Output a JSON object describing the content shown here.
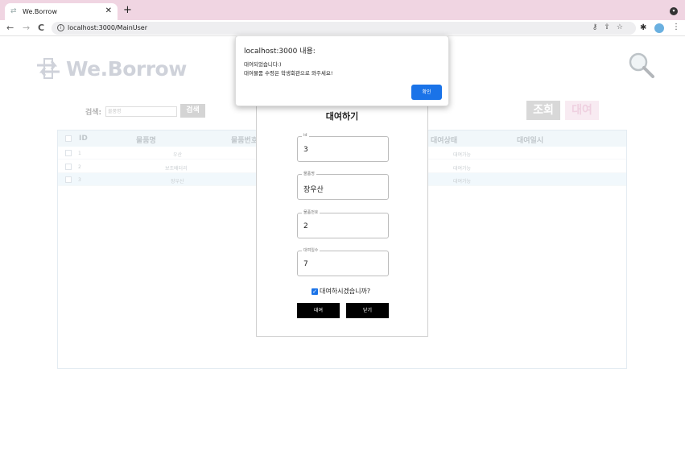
{
  "browser": {
    "tab_title": "We.Borrow",
    "tab_close": "✕",
    "new_tab": "+",
    "url": "localhost:3000/MainUser",
    "back": "←",
    "forward": "→",
    "reload": "C"
  },
  "page": {
    "logo_text": "We.Borrow",
    "search_label": "검색:",
    "search_placeholder": "물품명",
    "search_button": "검색",
    "query_button": "조회",
    "rent_button": "대여"
  },
  "grid": {
    "columns": [
      "ID",
      "물품명",
      "물품번호",
      "대여상태",
      "대여일시"
    ],
    "rows": [
      {
        "id": "1",
        "name": "우산",
        "status": "대여가능"
      },
      {
        "id": "2",
        "name": "보조배터리",
        "status": "대여가능"
      },
      {
        "id": "3",
        "name": "장우산",
        "status": "대여가능"
      }
    ]
  },
  "modal": {
    "title": "대여하기",
    "fields": [
      {
        "label": "id",
        "value": "3"
      },
      {
        "label": "물품명",
        "value": "장우산"
      },
      {
        "label": "물품번호",
        "value": "2"
      },
      {
        "label": "대여일수",
        "value": "7"
      }
    ],
    "confirm_label": "대여하시겠습니까?",
    "rent_button": "대여",
    "close_button": "닫기"
  },
  "alert": {
    "title": "localhost:3000 내용:",
    "message_line1": "대여되었습니다:)",
    "message_line2": "대여물품 수령은 학생회관으로 와주세요!",
    "ok_button": "확인",
    "ok_color": "#1a73e8"
  },
  "colors": {
    "tabbar_bg": "#f0d5e2",
    "rent_accent": "#f5e0ec"
  }
}
